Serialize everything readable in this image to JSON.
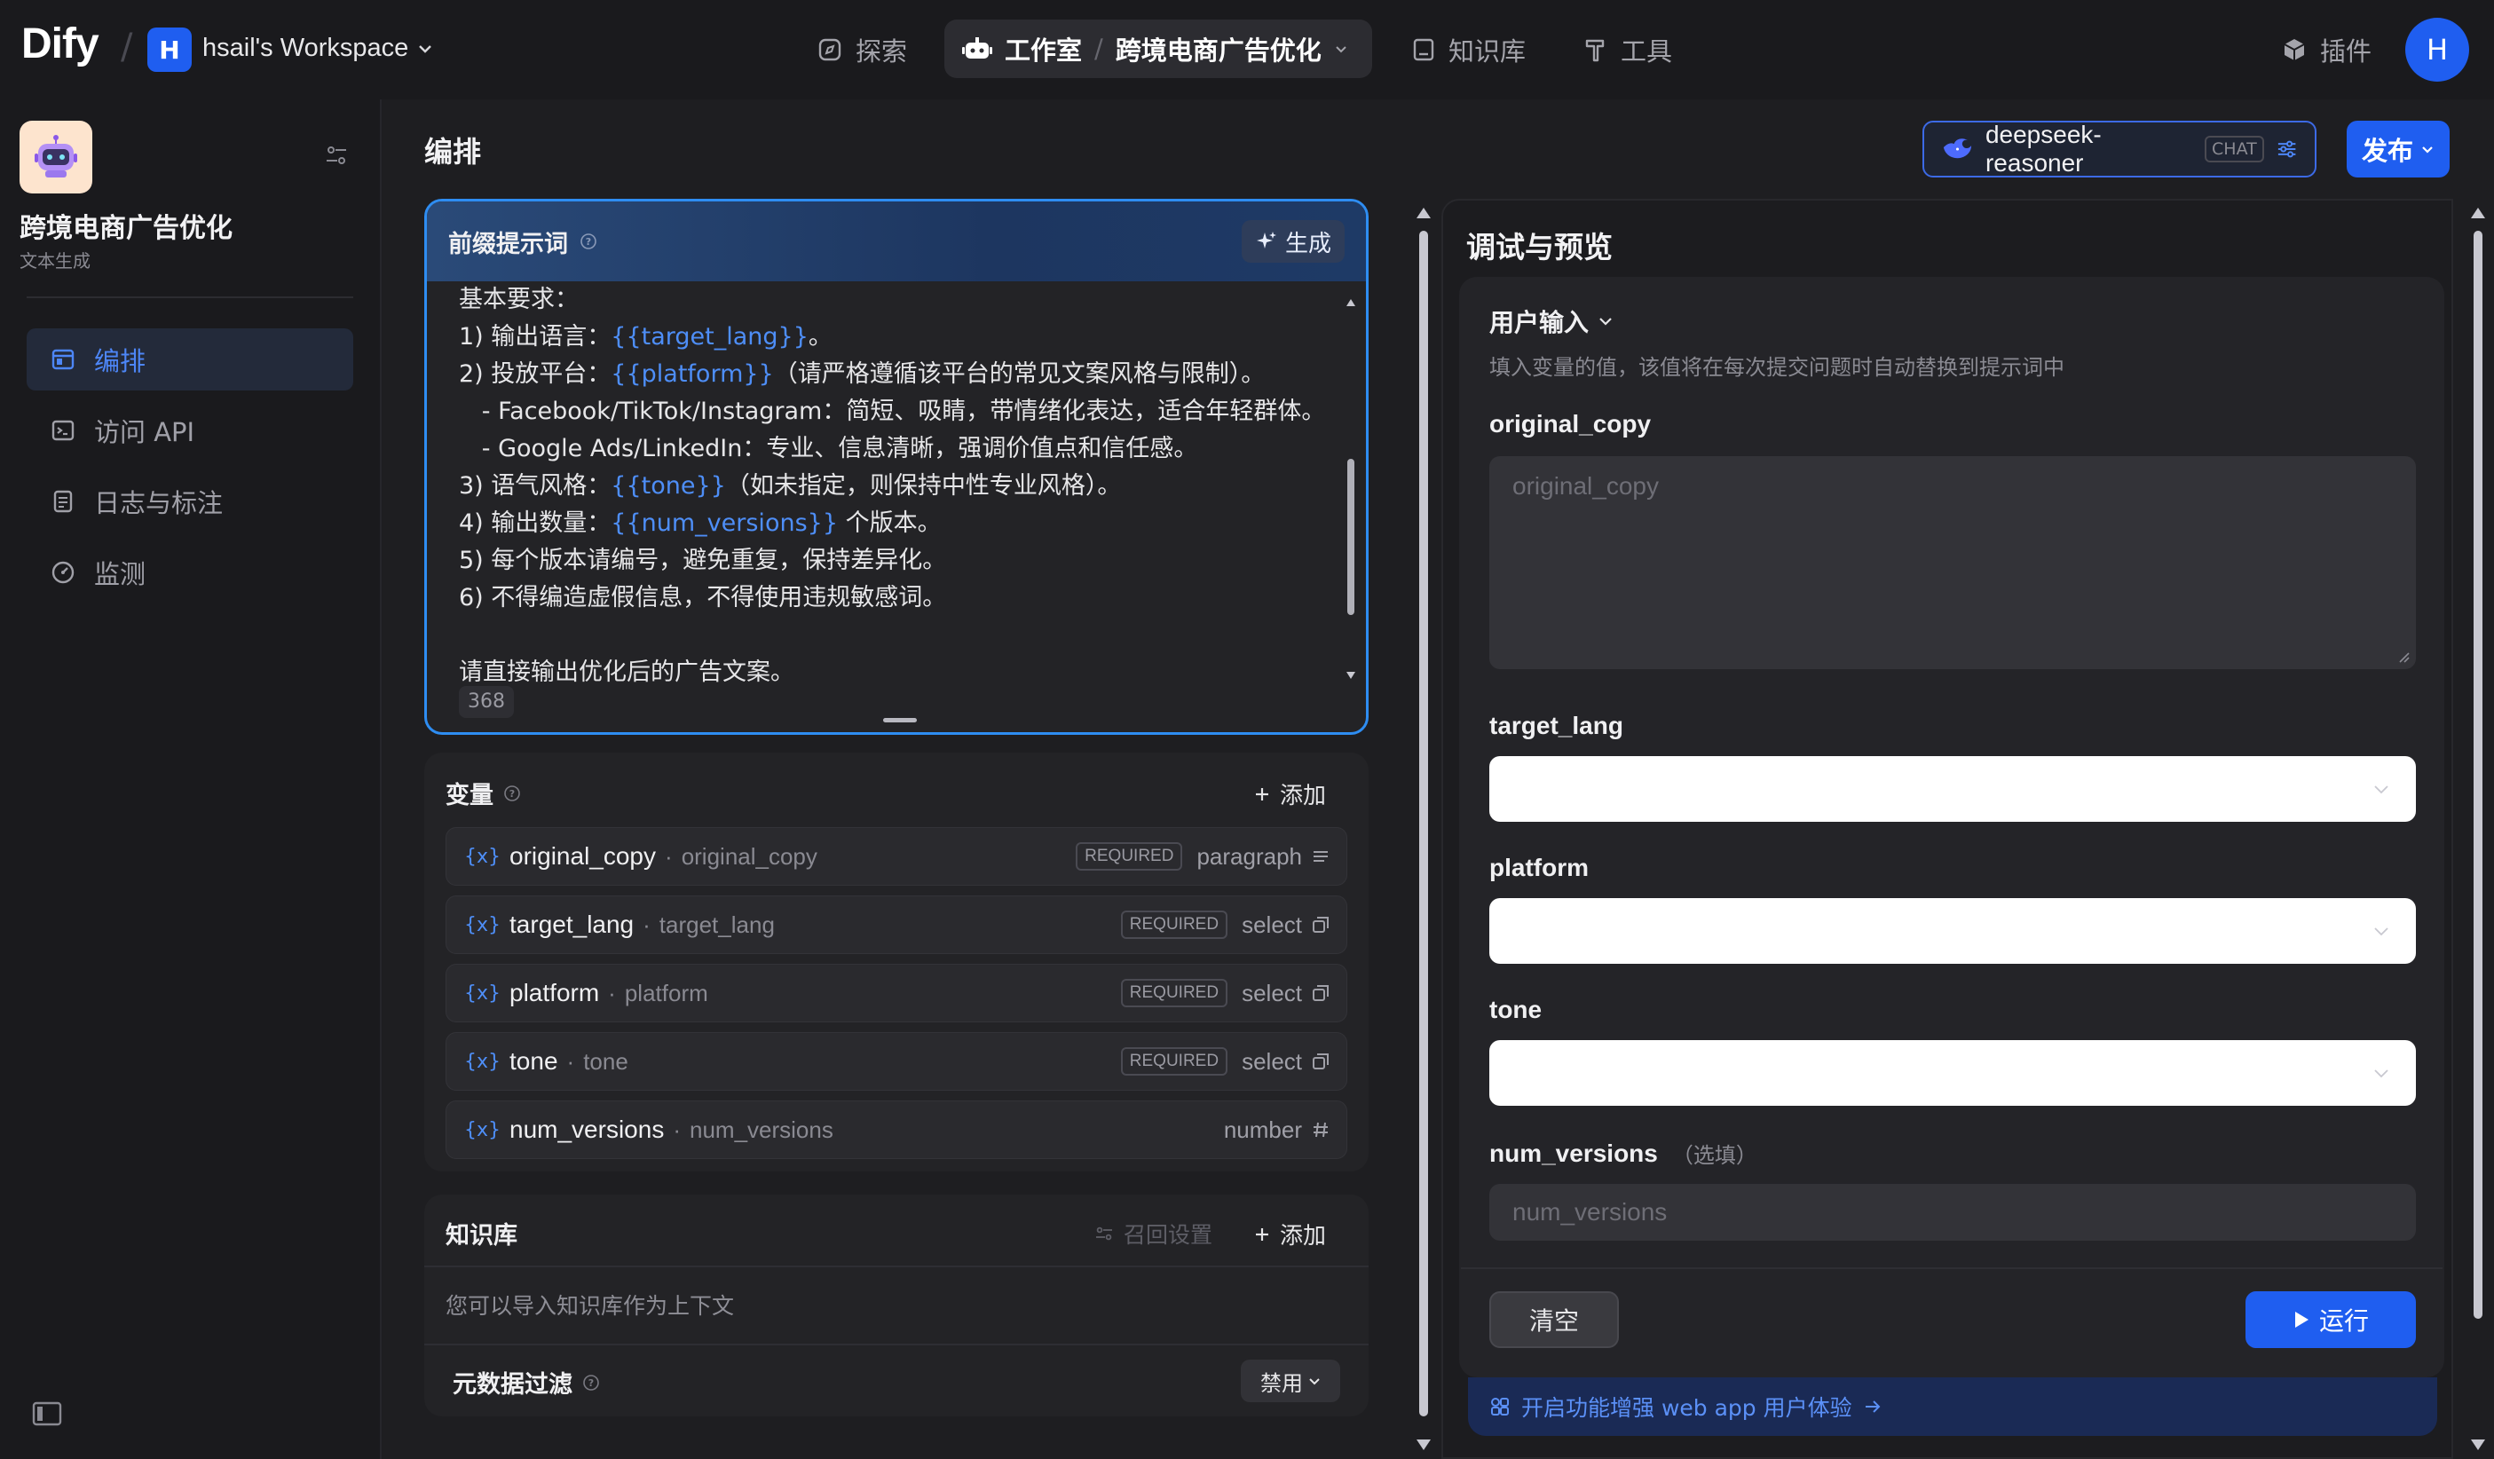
{
  "topbar": {
    "logo": "Dify",
    "workspace_initial": "H",
    "workspace_name": "hsail's Workspace",
    "nav": {
      "explore": "探索",
      "studio": "工作室",
      "current_app": "跨境电商广告优化",
      "knowledge": "知识库",
      "tools": "工具",
      "plugins": "插件"
    },
    "user_initial": "H"
  },
  "sidebar": {
    "app_name": "跨境电商广告优化",
    "app_type": "文本生成",
    "items": [
      {
        "label": "编排",
        "icon": "layout-icon",
        "active": true
      },
      {
        "label": "访问 API",
        "icon": "terminal-icon",
        "active": false
      },
      {
        "label": "日志与标注",
        "icon": "file-list-icon",
        "active": false
      },
      {
        "label": "监测",
        "icon": "dashboard-icon",
        "active": false
      }
    ]
  },
  "header": {
    "title": "编排",
    "model_name": "deepseek-reasoner",
    "model_mode": "CHAT",
    "publish_label": "发布"
  },
  "prompt": {
    "title": "前缀提示词",
    "generate_label": "生成",
    "lines": [
      [
        {
          "t": "基本要求："
        }
      ],
      [
        {
          "t": "1) 输出语言："
        },
        {
          "t": "{{target_lang}}",
          "v": true
        },
        {
          "t": "。"
        }
      ],
      [
        {
          "t": "2) 投放平台："
        },
        {
          "t": "{{platform}}",
          "v": true
        },
        {
          "t": "（请严格遵循该平台的常见文案风格与限制）。"
        }
      ],
      [
        {
          "t": "   - Facebook/TikTok/Instagram：简短、吸睛，带情绪化表达，适合年轻群体。"
        }
      ],
      [
        {
          "t": "   - Google Ads/LinkedIn：专业、信息清晰，强调价值点和信任感。"
        }
      ],
      [
        {
          "t": "3) 语气风格："
        },
        {
          "t": "{{tone}}",
          "v": true
        },
        {
          "t": "（如未指定，则保持中性专业风格）。"
        }
      ],
      [
        {
          "t": "4) 输出数量："
        },
        {
          "t": "{{num_versions}}",
          "v": true
        },
        {
          "t": " 个版本。"
        }
      ],
      [
        {
          "t": "5) 每个版本请编号，避免重复，保持差异化。"
        }
      ],
      [
        {
          "t": "6) 不得编造虚假信息，不得使用违规敏感词。"
        }
      ],
      [
        {
          "t": ""
        }
      ],
      [
        {
          "t": "请直接输出优化后的广告文案。"
        }
      ]
    ],
    "char_count": "368"
  },
  "variables": {
    "title": "变量",
    "add_label": "添加",
    "items": [
      {
        "name": "original_copy",
        "key": "original_copy",
        "required": "REQUIRED",
        "type": "paragraph",
        "type_icon": "paragraph-icon"
      },
      {
        "name": "target_lang",
        "key": "target_lang",
        "required": "REQUIRED",
        "type": "select",
        "type_icon": "select-icon"
      },
      {
        "name": "platform",
        "key": "platform",
        "required": "REQUIRED",
        "type": "select",
        "type_icon": "select-icon"
      },
      {
        "name": "tone",
        "key": "tone",
        "required": "REQUIRED",
        "type": "select",
        "type_icon": "select-icon"
      },
      {
        "name": "num_versions",
        "key": "num_versions",
        "required": "",
        "type": "number",
        "type_icon": "hash-icon"
      }
    ]
  },
  "knowledge": {
    "title": "知识库",
    "recall_label": "召回设置",
    "add_label": "添加",
    "description": "您可以导入知识库作为上下文",
    "metadata_filter_label": "元数据过滤",
    "metadata_filter_value": "禁用"
  },
  "preview": {
    "title": "调试与预览",
    "user_input_title": "用户输入",
    "user_input_desc": "填入变量的值，该值将在每次提交问题时自动替换到提示词中",
    "fields": {
      "original_copy": {
        "label": "original_copy",
        "placeholder": "original_copy"
      },
      "target_lang": {
        "label": "target_lang"
      },
      "platform": {
        "label": "platform"
      },
      "tone": {
        "label": "tone"
      },
      "num_versions": {
        "label": "num_versions",
        "optional": "（选填）",
        "placeholder": "num_versions"
      }
    },
    "clear_label": "清空",
    "run_label": "运行",
    "enhance_label": "开启功能增强 web app 用户体验"
  },
  "colors": {
    "accent": "#1f5ef0",
    "variable": "#4e8ef7",
    "prompt_border": "#2e8df2"
  }
}
